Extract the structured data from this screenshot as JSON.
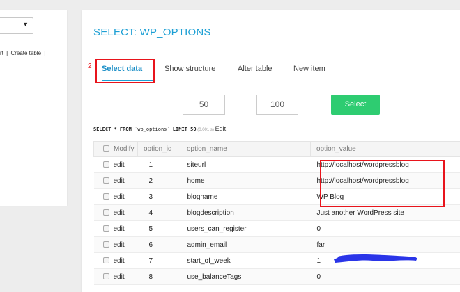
{
  "sidebar": {
    "links": [
      "rt",
      "|",
      "Create table",
      "|"
    ]
  },
  "main": {
    "title": "SELECT: WP_OPTIONS",
    "annotation_number": "2",
    "tabs": [
      {
        "label": "Select data",
        "active": true
      },
      {
        "label": "Show structure"
      },
      {
        "label": "Alter table"
      },
      {
        "label": "New item"
      }
    ],
    "limit_input": "50",
    "text_length_input": "100",
    "select_button": "Select",
    "sql": {
      "prefix": "SELECT * FROM ",
      "table": "`wp_options`",
      "limit_kw": " LIMIT ",
      "limit_val": "50",
      "time": " (0.001 s) ",
      "edit": "Edit"
    }
  },
  "table": {
    "headers": [
      "Modify",
      "option_id",
      "option_name",
      "option_value"
    ],
    "rows": [
      {
        "modify": "edit",
        "id": "1",
        "name": "siteurl",
        "value": "http://localhost/wordpressblog"
      },
      {
        "modify": "edit",
        "id": "2",
        "name": "home",
        "value": "http://localhost/wordpressblog"
      },
      {
        "modify": "edit",
        "id": "3",
        "name": "blogname",
        "value": "WP Blog"
      },
      {
        "modify": "edit",
        "id": "4",
        "name": "blogdescription",
        "value": "Just another WordPress site"
      },
      {
        "modify": "edit",
        "id": "5",
        "name": "users_can_register",
        "value": "0"
      },
      {
        "modify": "edit",
        "id": "6",
        "name": "admin_email",
        "value": "far"
      },
      {
        "modify": "edit",
        "id": "7",
        "name": "start_of_week",
        "value": "1"
      },
      {
        "modify": "edit",
        "id": "8",
        "name": "use_balanceTags",
        "value": "0"
      }
    ]
  },
  "colors": {
    "accent": "#1c9fd4",
    "button": "#2ecc71",
    "annotation": "#e8141c",
    "redaction": "#2a35e8"
  }
}
